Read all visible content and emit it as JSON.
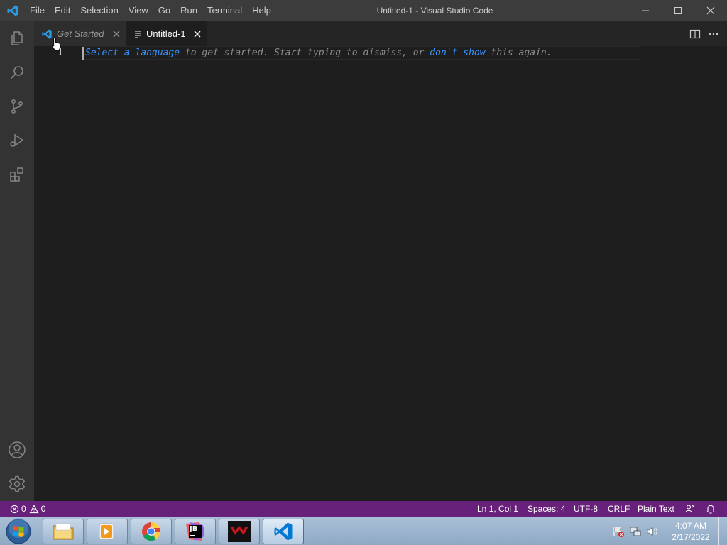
{
  "titlebar": {
    "window_title": "Untitled-1 - Visual Studio Code",
    "menu": [
      "File",
      "Edit",
      "Selection",
      "View",
      "Go",
      "Run",
      "Terminal",
      "Help"
    ]
  },
  "activity_bar": {
    "items": [
      "files-icon",
      "search-icon",
      "source-control-icon",
      "run-debug-icon",
      "extensions-icon"
    ],
    "bottom_items": [
      "account-icon",
      "manage-gear-icon"
    ]
  },
  "tabs": [
    {
      "label": "Get Started",
      "icon": "vscode-logo-icon",
      "active": false
    },
    {
      "label": "Untitled-1",
      "icon": "text-file-icon",
      "active": true
    }
  ],
  "editor": {
    "line_number": "1",
    "hint": {
      "link1": "Select a language",
      "text1": " to get started. Start typing to dismiss, or ",
      "link2": "don't show",
      "text2": " this again."
    }
  },
  "statusbar": {
    "errors": "0",
    "warnings": "0",
    "position": "Ln 1, Col 1",
    "spaces": "Spaces: 4",
    "encoding": "UTF-8",
    "eol": "CRLF",
    "language": "Plain Text"
  },
  "taskbar": {
    "apps": [
      "file-explorer-icon",
      "media-player-icon",
      "chrome-icon",
      "jetbrains-icon",
      "game-icon",
      "vscode-icon"
    ],
    "jetbrains_label": "JB",
    "time": "4:07 AM",
    "date": "2/17/2022"
  },
  "colors": {
    "statusbar": "#68217a",
    "titlebar": "#3c3c3c",
    "activitybar": "#333333",
    "editor": "#1e1e1e",
    "link": "#3794ff",
    "vscode_blue": "#0078d4"
  }
}
